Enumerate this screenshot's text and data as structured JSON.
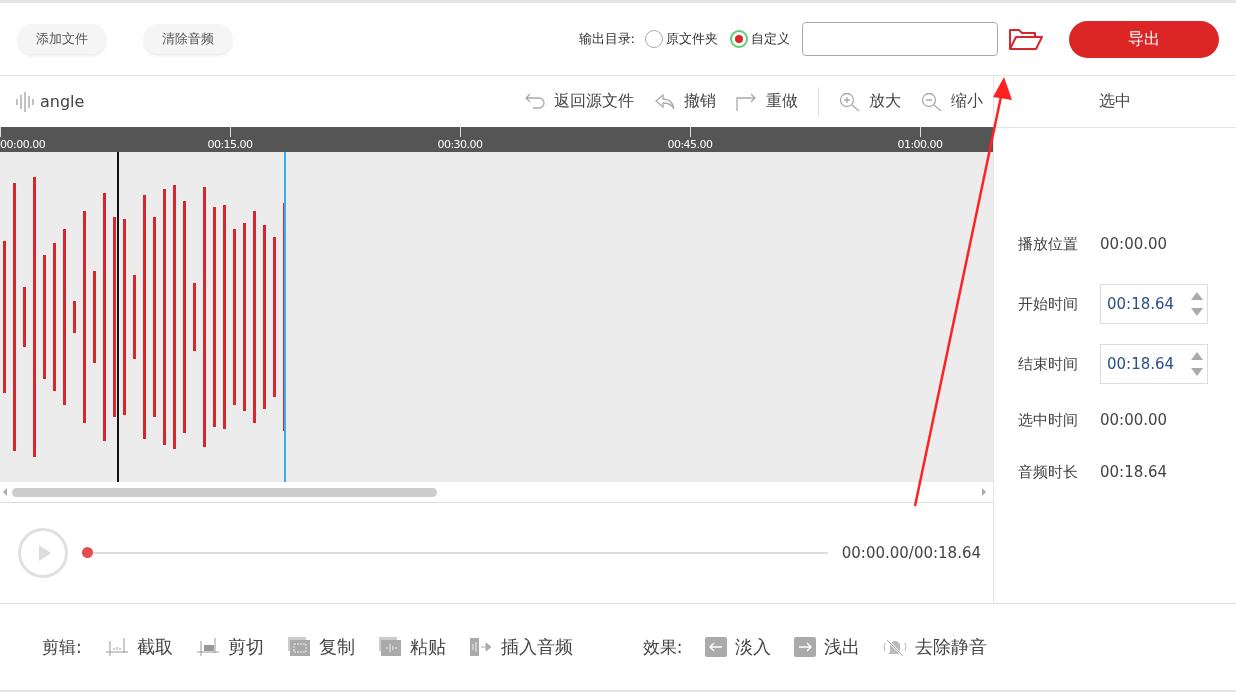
{
  "top_bar": {
    "buttons": [
      "添加文件",
      "清除音频"
    ],
    "output_label": "输出目录:",
    "output_options": [
      {
        "label": "原文件夹",
        "selected": false
      },
      {
        "label": "自定义",
        "selected": true
      }
    ],
    "export_button": "导出"
  },
  "toolbar": {
    "file_name": "angle",
    "actions": [
      {
        "kind": "back",
        "label": "返回源文件"
      },
      {
        "kind": "undo",
        "label": "撤销"
      },
      {
        "kind": "redo",
        "label": "重做"
      },
      {
        "kind": "zoom-in",
        "label": "放大"
      },
      {
        "kind": "zoom-out",
        "label": "缩小"
      }
    ]
  },
  "ruler": {
    "ticks": [
      "00:00.00",
      "00:15.00",
      "00:30.00",
      "00:45.00",
      "01:00.00"
    ]
  },
  "player": {
    "level": 0,
    "time": "00:00.00/00:18.64"
  },
  "side_panel": {
    "title": "选中",
    "rows": [
      {
        "kind": "text",
        "label": "播放位置",
        "value": "00:00.00"
      },
      {
        "kind": "spinner",
        "label": "开始时间",
        "value": "00:18.64"
      },
      {
        "kind": "spinner",
        "label": "结束时间",
        "value": "00:18.64"
      },
      {
        "kind": "text",
        "label": "选中时间",
        "value": "00:00.00"
      },
      {
        "kind": "text",
        "label": "音频时长",
        "value": "00:18.64"
      }
    ]
  },
  "edit_bar": {
    "label": "剪辑:",
    "actions": [
      {
        "kind": "trim",
        "label": "截取"
      },
      {
        "kind": "cut",
        "label": "剪切"
      },
      {
        "kind": "copy",
        "label": "复制"
      },
      {
        "kind": "paste",
        "label": "粘贴"
      },
      {
        "kind": "insert",
        "label": "插入音频"
      }
    ]
  },
  "effects_bar": {
    "label": "效果:",
    "actions": [
      {
        "kind": "fade-in",
        "label": "淡入"
      },
      {
        "kind": "fade-out",
        "label": "浅出"
      },
      {
        "kind": "mute",
        "label": "去除静音"
      }
    ]
  }
}
